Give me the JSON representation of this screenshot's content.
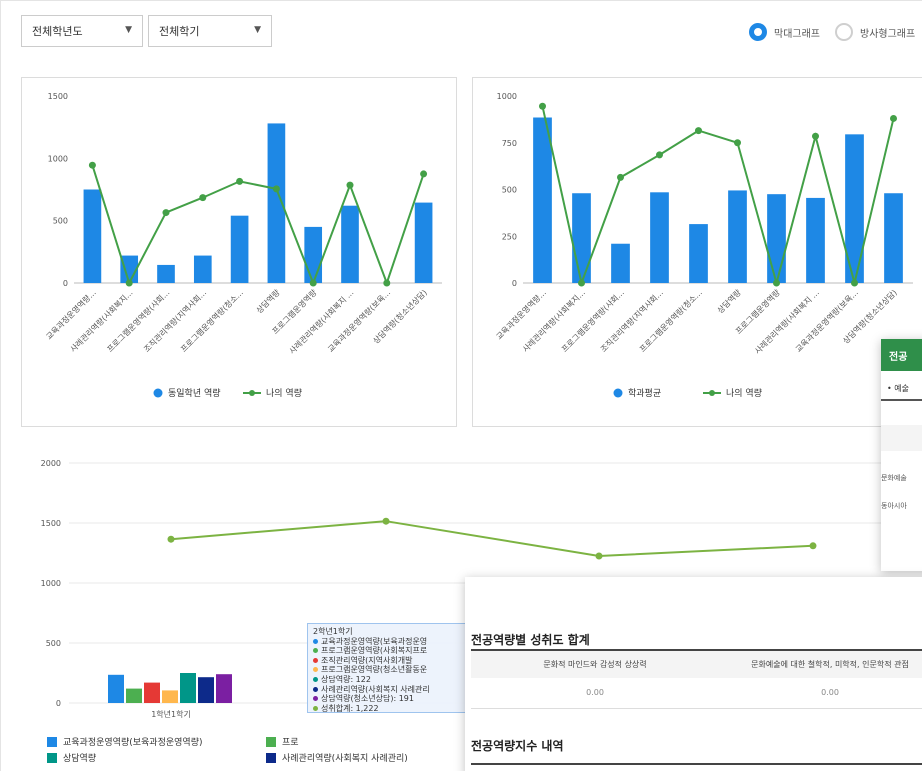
{
  "filters": {
    "year": "전체학년도",
    "semester": "전체학기"
  },
  "graph_type": {
    "bar": "막대그래프",
    "radar": "방사형그래프"
  },
  "chart_data": [
    {
      "type": "bar",
      "categories": [
        "교육과정운영역량...",
        "사례관리역량(사회복지...",
        "프로그램운영역량(사회...",
        "조직관리역량(지역사회...",
        "프로그램운영역량(청소...",
        "상담역량",
        "프로그램운영역량",
        "사례관리역량(사회복지 ...",
        "교육과정운영역량(보육...",
        "상담역량(청소년상담)"
      ],
      "series": [
        {
          "name": "동일학년 역량",
          "values": [
            750,
            220,
            145,
            220,
            540,
            1280,
            450,
            620,
            0,
            645
          ]
        },
        {
          "name": "나의 역량",
          "values": [
            945,
            0,
            565,
            685,
            815,
            755,
            0,
            785,
            0,
            875
          ]
        }
      ],
      "ylim": [
        0,
        1500
      ],
      "yticks": [
        "1500",
        "1000",
        "500",
        "0"
      ]
    },
    {
      "type": "bar",
      "categories": [
        "교육과정운영역량...",
        "사례관리역량(사회복지...",
        "프로그램운영역량(사회...",
        "조직관리역량(지역사회...",
        "프로그램운영역량(청소...",
        "상담역량",
        "프로그램운영역량",
        "사례관리역량(사회복지 ...",
        "교육과정운영역량(보육...",
        "상담역량(청소년상담)"
      ],
      "series": [
        {
          "name": "학과평균",
          "values": [
            885,
            480,
            210,
            485,
            315,
            495,
            475,
            455,
            795,
            480
          ]
        },
        {
          "name": "나의 역량",
          "values": [
            945,
            0,
            565,
            685,
            815,
            750,
            0,
            785,
            0,
            880
          ]
        }
      ],
      "ylim": [
        0,
        1000
      ],
      "yticks": [
        "1000",
        "750",
        "500",
        "250",
        "0"
      ]
    },
    {
      "type": "bar",
      "categories": [
        "1학년1학기"
      ],
      "line": [
        1365,
        1515,
        1225,
        1310
      ],
      "bars_1st": [
        235,
        120,
        170,
        105,
        250,
        215,
        240
      ],
      "ylim": [
        0,
        2000
      ],
      "yticks": [
        "2000",
        "1500",
        "1000",
        "500",
        "0"
      ]
    }
  ],
  "chart3_legend": [
    {
      "label": "교육과정운영역량(보육과정운영역량)",
      "color": "#1e88e5"
    },
    {
      "label": "프로",
      "color": "#4caf50"
    },
    {
      "label": "상담역량",
      "color": "#009688"
    },
    {
      "label": "사례관리역량(사회복지 사례관리)",
      "color": "#0d2a8a"
    }
  ],
  "tooltip": {
    "title": "2학년1학기",
    "rows": [
      {
        "text": "교육과정운영역량(보육과정운영",
        "color": "#1e88e5"
      },
      {
        "text": "프로그램운영역량(사회복지프로",
        "color": "#4caf50"
      },
      {
        "text": "조직관리역량(지역사회개발",
        "color": "#e53935"
      },
      {
        "text": "프로그램운영역량(청소년활동운",
        "color": "#ffb74d"
      },
      {
        "text": "상담역량: 122",
        "color": "#009688"
      },
      {
        "text": "사례관리역량(사회복지 사례관리",
        "color": "#0d2a8a"
      },
      {
        "text": "상담역량(청소년상담): 191",
        "color": "#7b1fa2"
      },
      {
        "text": "성취합계: 1,222",
        "color": "#7cb342"
      }
    ]
  },
  "overlay_green": {
    "head": "전공",
    "bullet": "• 예술",
    "row1": "문화예술",
    "row2": "동아시아"
  },
  "overlay_bottom": {
    "title1": "전공역량별 성취도 합계",
    "col1": "문화적 마인드와 감성적 상상력",
    "col2": "문화예술에 대한 철학적, 미학적, 인문학적 관점",
    "val1": "0.00",
    "val2": "0.00",
    "title2": "전공역량지수 내역"
  }
}
